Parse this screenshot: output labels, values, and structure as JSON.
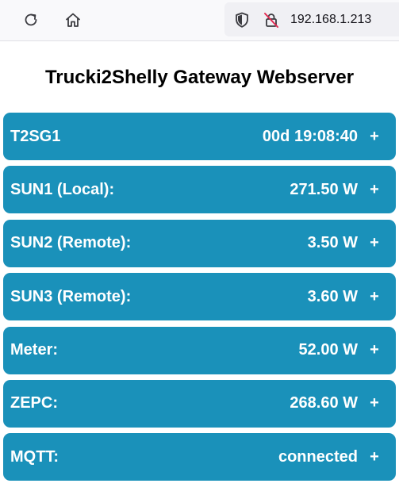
{
  "browser": {
    "url": "192.168.1.213",
    "icons": [
      "reload-icon",
      "home-icon",
      "shield-icon",
      "insecure-lock-icon"
    ]
  },
  "page": {
    "title": "Trucki2Shelly Gateway Webserver"
  },
  "cards": [
    {
      "label": "T2SG1",
      "value": "00d 19:08:40",
      "toggle": "+"
    },
    {
      "label": "SUN1 (Local):",
      "value": "271.50 W",
      "toggle": "+"
    },
    {
      "label": "SUN2 (Remote):",
      "value": "3.50 W",
      "toggle": "+"
    },
    {
      "label": "SUN3 (Remote):",
      "value": "3.60 W",
      "toggle": "+"
    },
    {
      "label": "Meter:",
      "value": "52.00 W",
      "toggle": "+"
    },
    {
      "label": "ZEPC:",
      "value": "268.60 W",
      "toggle": "+"
    },
    {
      "label": "MQTT:",
      "value": "connected",
      "toggle": "+"
    }
  ],
  "colors": {
    "card_background": "#1a91ba",
    "card_text": "#ffffff",
    "title_text": "#000000"
  }
}
